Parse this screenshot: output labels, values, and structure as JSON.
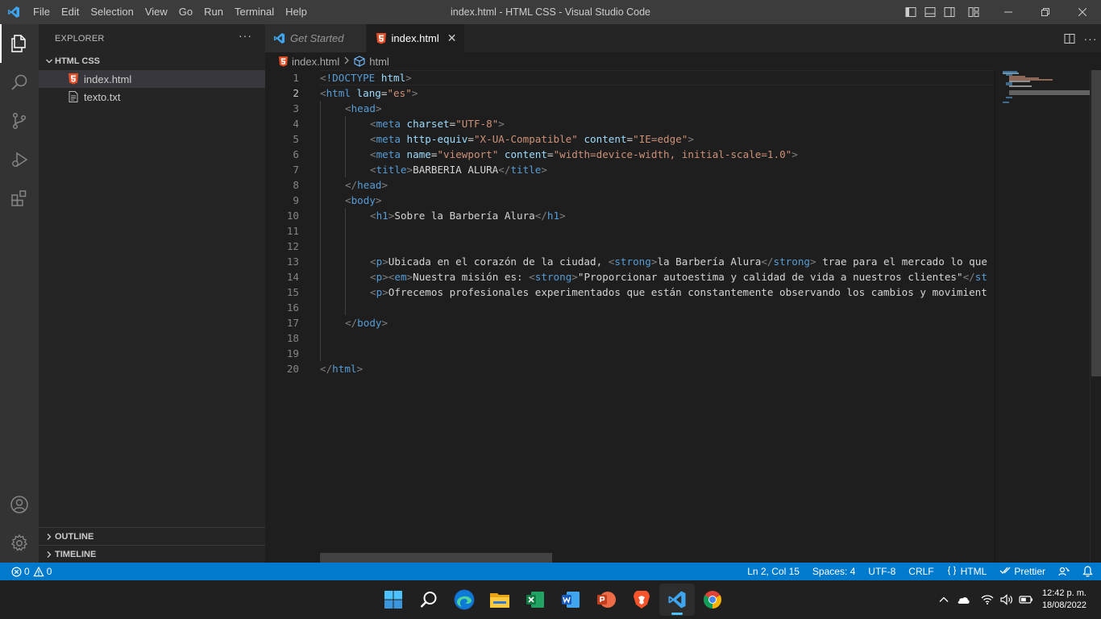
{
  "window": {
    "title": "index.html - HTML CSS - Visual Studio Code",
    "menu": [
      "File",
      "Edit",
      "Selection",
      "View",
      "Go",
      "Run",
      "Terminal",
      "Help"
    ]
  },
  "activity_bar": {
    "items": [
      "explorer-icon",
      "search-icon",
      "source-control-icon",
      "run-debug-icon",
      "extensions-icon"
    ],
    "bottom": [
      "account-icon",
      "settings-gear-icon"
    ]
  },
  "sidebar": {
    "header": "EXPLORER",
    "more": "···",
    "folder": "HTML CSS",
    "files": [
      {
        "name": "index.html",
        "icon": "html5-icon",
        "selected": true
      },
      {
        "name": "texto.txt",
        "icon": "text-file-icon",
        "selected": false
      }
    ],
    "outline": "OUTLINE",
    "timeline": "TIMELINE"
  },
  "tabs": [
    {
      "label": "Get Started",
      "icon": "vscode-icon",
      "active": false
    },
    {
      "label": "index.html",
      "icon": "html5-icon",
      "active": true,
      "close": "✕"
    }
  ],
  "breadcrumb": {
    "file": "index.html",
    "symbol": "html"
  },
  "editor": {
    "current_line": 2,
    "lines": [
      {
        "n": "1",
        "indent": 0,
        "tokens": [
          [
            "b",
            "<"
          ],
          [
            "g",
            "!DOCTYPE"
          ],
          [
            "t",
            " "
          ],
          [
            "a",
            "html"
          ],
          [
            "b",
            ">"
          ]
        ]
      },
      {
        "n": "2",
        "indent": 0,
        "tokens": [
          [
            "b",
            "<"
          ],
          [
            "g",
            "html"
          ],
          [
            "t",
            " "
          ],
          [
            "a",
            "lang"
          ],
          [
            "t",
            "="
          ],
          [
            "s",
            "\"es\""
          ],
          [
            "b",
            ">"
          ]
        ]
      },
      {
        "n": "3",
        "indent": 1,
        "tokens": [
          [
            "b",
            "<"
          ],
          [
            "g",
            "head"
          ],
          [
            "b",
            ">"
          ]
        ]
      },
      {
        "n": "4",
        "indent": 2,
        "tokens": [
          [
            "b",
            "<"
          ],
          [
            "g",
            "meta"
          ],
          [
            "t",
            " "
          ],
          [
            "a",
            "charset"
          ],
          [
            "t",
            "="
          ],
          [
            "s",
            "\"UTF-8\""
          ],
          [
            "b",
            ">"
          ]
        ]
      },
      {
        "n": "5",
        "indent": 2,
        "tokens": [
          [
            "b",
            "<"
          ],
          [
            "g",
            "meta"
          ],
          [
            "t",
            " "
          ],
          [
            "a",
            "http-equiv"
          ],
          [
            "t",
            "="
          ],
          [
            "s",
            "\"X-UA-Compatible\""
          ],
          [
            "t",
            " "
          ],
          [
            "a",
            "content"
          ],
          [
            "t",
            "="
          ],
          [
            "s",
            "\"IE=edge\""
          ],
          [
            "b",
            ">"
          ]
        ]
      },
      {
        "n": "6",
        "indent": 2,
        "tokens": [
          [
            "b",
            "<"
          ],
          [
            "g",
            "meta"
          ],
          [
            "t",
            " "
          ],
          [
            "a",
            "name"
          ],
          [
            "t",
            "="
          ],
          [
            "s",
            "\"viewport\""
          ],
          [
            "t",
            " "
          ],
          [
            "a",
            "content"
          ],
          [
            "t",
            "="
          ],
          [
            "s",
            "\"width=device-width, initial-scale=1.0\""
          ],
          [
            "b",
            ">"
          ]
        ]
      },
      {
        "n": "7",
        "indent": 2,
        "tokens": [
          [
            "b",
            "<"
          ],
          [
            "g",
            "title"
          ],
          [
            "b",
            ">"
          ],
          [
            "t",
            "BARBERIA ALURA"
          ],
          [
            "b",
            "</"
          ],
          [
            "g",
            "title"
          ],
          [
            "b",
            ">"
          ]
        ]
      },
      {
        "n": "8",
        "indent": 1,
        "tokens": [
          [
            "b",
            "</"
          ],
          [
            "g",
            "head"
          ],
          [
            "b",
            ">"
          ]
        ]
      },
      {
        "n": "9",
        "indent": 1,
        "tokens": [
          [
            "b",
            "<"
          ],
          [
            "g",
            "body"
          ],
          [
            "b",
            ">"
          ]
        ]
      },
      {
        "n": "10",
        "indent": 2,
        "tokens": [
          [
            "b",
            "<"
          ],
          [
            "g",
            "h1"
          ],
          [
            "b",
            ">"
          ],
          [
            "t",
            "Sobre la Barbería Alura"
          ],
          [
            "b",
            "</"
          ],
          [
            "g",
            "h1"
          ],
          [
            "b",
            ">"
          ]
        ]
      },
      {
        "n": "11",
        "indent": 0,
        "tokens": []
      },
      {
        "n": "12",
        "indent": 0,
        "tokens": []
      },
      {
        "n": "13",
        "indent": 2,
        "tokens": [
          [
            "b",
            "<"
          ],
          [
            "g",
            "p"
          ],
          [
            "b",
            ">"
          ],
          [
            "t",
            "Ubicada en el corazón de la ciudad, "
          ],
          [
            "b",
            "<"
          ],
          [
            "g",
            "strong"
          ],
          [
            "b",
            ">"
          ],
          [
            "t",
            "la Barbería Alura"
          ],
          [
            "b",
            "</"
          ],
          [
            "g",
            "strong"
          ],
          [
            "b",
            ">"
          ],
          [
            "t",
            " trae para el mercado lo que"
          ]
        ]
      },
      {
        "n": "14",
        "indent": 2,
        "tokens": [
          [
            "b",
            "<"
          ],
          [
            "g",
            "p"
          ],
          [
            "b",
            ">"
          ],
          [
            "b",
            "<"
          ],
          [
            "g",
            "em"
          ],
          [
            "b",
            ">"
          ],
          [
            "t",
            "Nuestra misión es: "
          ],
          [
            "b",
            "<"
          ],
          [
            "g",
            "strong"
          ],
          [
            "b",
            ">"
          ],
          [
            "t",
            "\"Proporcionar autoestima y calidad de vida a nuestros clientes\""
          ],
          [
            "b",
            "</"
          ],
          [
            "g",
            "st"
          ]
        ]
      },
      {
        "n": "15",
        "indent": 2,
        "tokens": [
          [
            "b",
            "<"
          ],
          [
            "g",
            "p"
          ],
          [
            "b",
            ">"
          ],
          [
            "t",
            "Ofrecemos profesionales experimentados que están constantemente observando los cambios y movimient"
          ]
        ]
      },
      {
        "n": "16",
        "indent": 0,
        "tokens": []
      },
      {
        "n": "17",
        "indent": 1,
        "tokens": [
          [
            "b",
            "</"
          ],
          [
            "g",
            "body"
          ],
          [
            "b",
            ">"
          ]
        ]
      },
      {
        "n": "18",
        "indent": 0,
        "tokens": []
      },
      {
        "n": "19",
        "indent": 0,
        "tokens": []
      },
      {
        "n": "20",
        "indent": 0,
        "tokens": [
          [
            "b",
            "</"
          ],
          [
            "g",
            "html"
          ],
          [
            "b",
            ">"
          ]
        ]
      }
    ]
  },
  "statusbar": {
    "errors": "0",
    "warnings": "0",
    "position": "Ln 2, Col 15",
    "spaces": "Spaces: 4",
    "encoding": "UTF-8",
    "eol": "CRLF",
    "language": "HTML",
    "formatter": "Prettier"
  },
  "taskbar": {
    "apps": [
      "windows-start-icon",
      "search-icon",
      "edge-icon",
      "file-explorer-icon",
      "excel-icon",
      "word-icon",
      "powerpoint-icon",
      "brave-icon",
      "vscode-icon",
      "chrome-icon"
    ],
    "active_app": "vscode-icon",
    "time": "12:42 p. m.",
    "date": "18/08/2022"
  },
  "colors": {
    "accent": "#007acc",
    "tag": "#569cd6",
    "attribute": "#9cdcfe",
    "string": "#ce9178"
  }
}
